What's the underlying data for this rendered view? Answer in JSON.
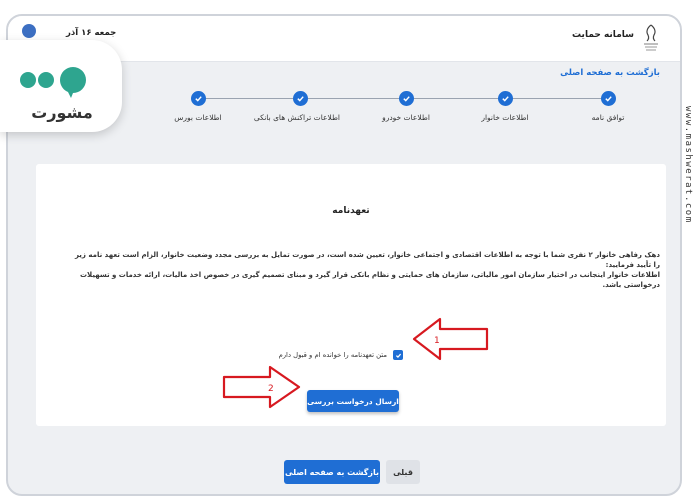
{
  "header": {
    "system_title": "سامانه حمایت",
    "date": "جمعه ۱۶ آذر"
  },
  "back_link": "بازگشت به صفحه اصلی",
  "stepper": {
    "steps": [
      {
        "label": "توافق نامه"
      },
      {
        "label": "اطلاعات خانوار"
      },
      {
        "label": "اطلاعات خودرو"
      },
      {
        "label": "اطلاعات تراکنش های بانکی"
      },
      {
        "label": "اطلاعات بورس"
      }
    ]
  },
  "agreement": {
    "title": "تعهدنامه",
    "text_line1": "دهک رفاهی خانوار ۲ نفری شما با توجه به اطلاعات اقتصادی و اجتماعی خانوار، تعیین شده است، در صورت تمایل به بررسی مجدد وضعیت خانوار، الزام است تعهد نامه زیر را تأیید فرمایید:",
    "text_line2": "اطلاعات خانوار اینجانب در اختیار سازمان امور مالیاتی، سازمان های حمایتی و نظام بانکی قرار گیرد و مبنای تصمیم گیری در خصوص اخذ مالیات، ارائه خدمات و تسهیلات درخواستی باشد.",
    "checkbox_label": "متن تعهدنامه را خوانده ام و قبول دارم",
    "submit_label": "ارسال درخواست بررسی"
  },
  "footer": {
    "back_button": "بازگشت به صفحه اصلی",
    "prev_button": "قبلی"
  },
  "annotations": {
    "arrow1_number": "1",
    "arrow2_number": "2"
  },
  "watermark": {
    "logo_text": "مشورت",
    "url": "www.mashwerat.com"
  },
  "colors": {
    "primary": "#1f6ed4",
    "annotation": "#d71920",
    "background": "#eef0f3"
  }
}
